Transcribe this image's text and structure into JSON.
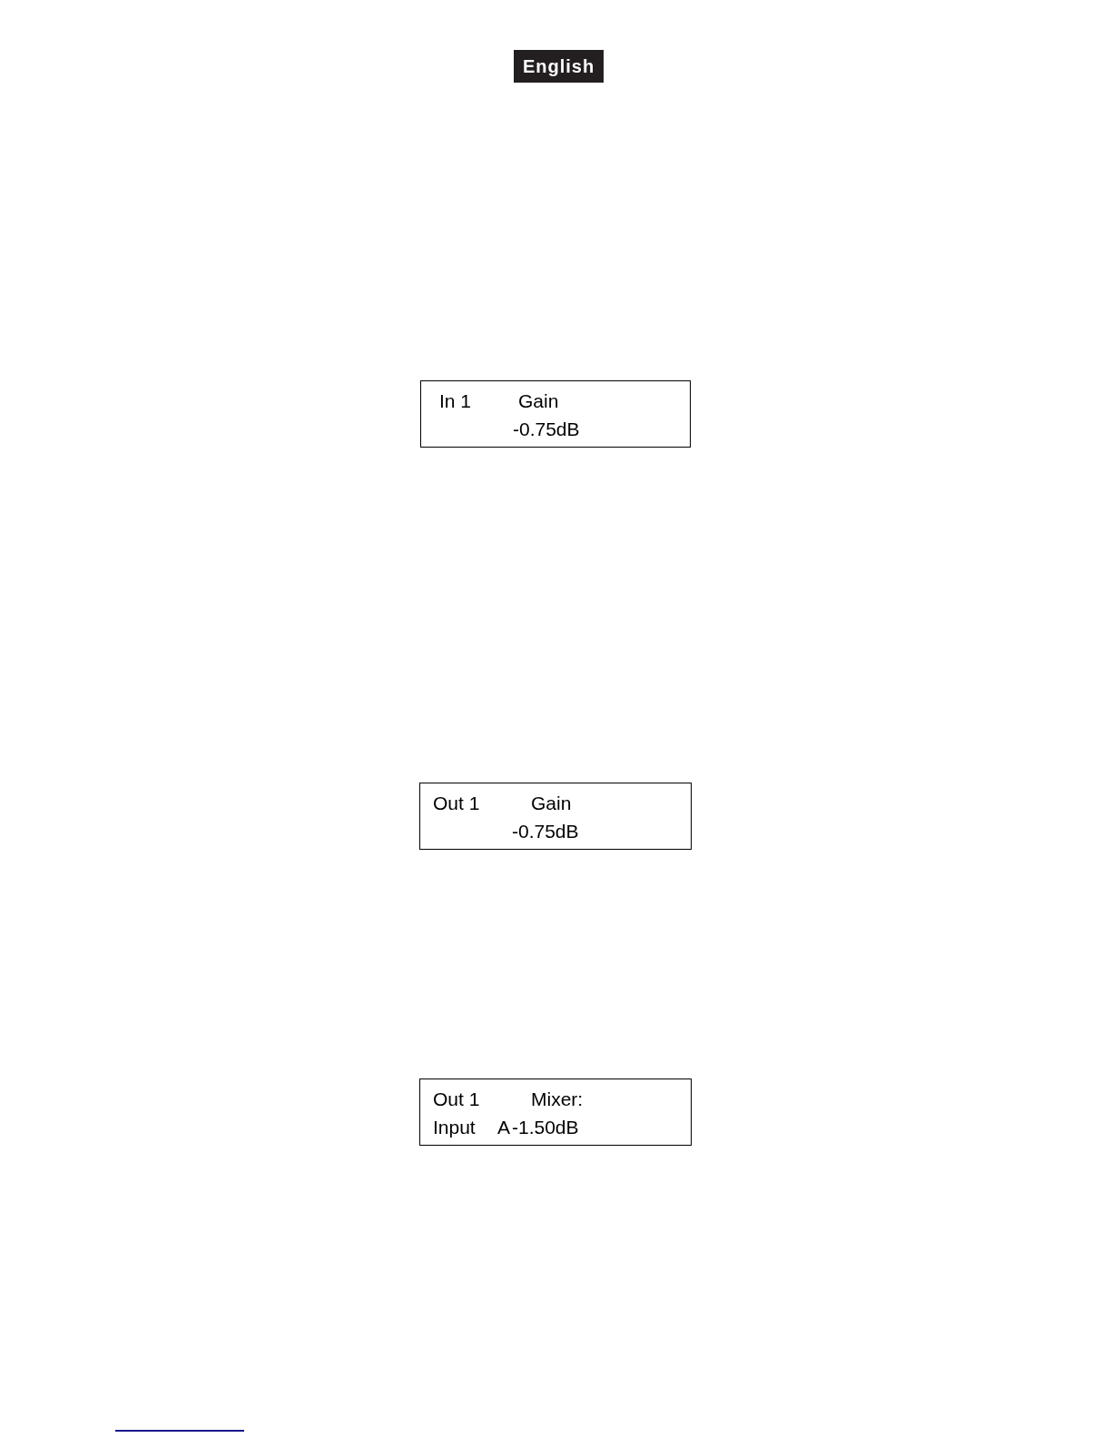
{
  "language_badge": "English",
  "displays": [
    {
      "line_1": [
        "In 1",
        "Gain"
      ],
      "line_2": [
        "-0.75dB"
      ]
    },
    {
      "line_1": [
        "Out 1",
        "Gain"
      ],
      "line_2": [
        "-0.75dB"
      ]
    },
    {
      "line_1": [
        "Out 1",
        "Mixer:"
      ],
      "line_2": [
        "Input",
        "A",
        "-1.50dB"
      ]
    }
  ]
}
